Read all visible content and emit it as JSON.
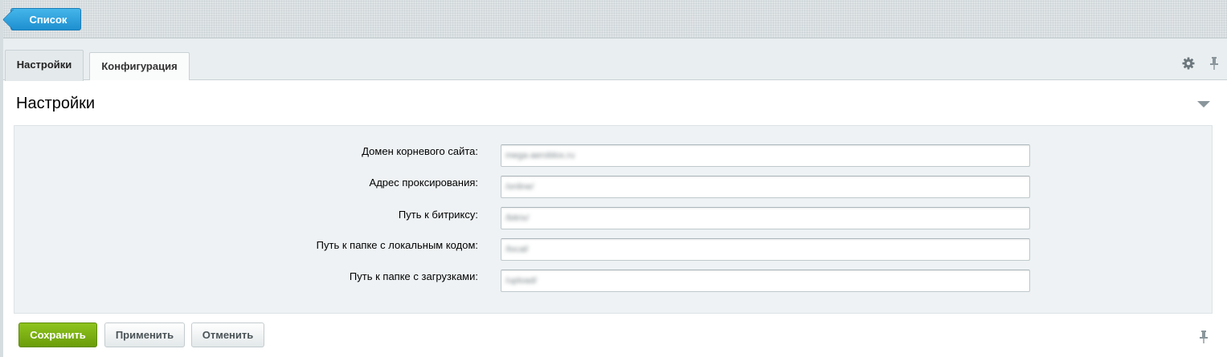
{
  "toolbar": {
    "back_label": "Список"
  },
  "tabs": [
    {
      "label": "Настройки",
      "active": true
    },
    {
      "label": "Конфигурация",
      "active": false
    }
  ],
  "tab_icons": {
    "settings_icon": "gear-icon",
    "pin_icon": "pin-icon"
  },
  "section": {
    "title": "Настройки"
  },
  "form": {
    "fields": [
      {
        "label": "Домен корневого сайта:",
        "value": "mega-aeroblox.ru"
      },
      {
        "label": "Адрес проксирования:",
        "value": "/online/"
      },
      {
        "label": "Путь к битриксу:",
        "value": "/bitrix/"
      },
      {
        "label": "Путь к папке с локальным кодом:",
        "value": "/local/"
      },
      {
        "label": "Путь к папке с загрузками:",
        "value": "/upload/"
      }
    ]
  },
  "buttons": {
    "save": "Сохранить",
    "apply": "Применить",
    "cancel": "Отменить"
  },
  "colors": {
    "accent_blue": "#1e8fd0",
    "save_green": "#7ab312",
    "panel_bg": "#eef2f4"
  }
}
